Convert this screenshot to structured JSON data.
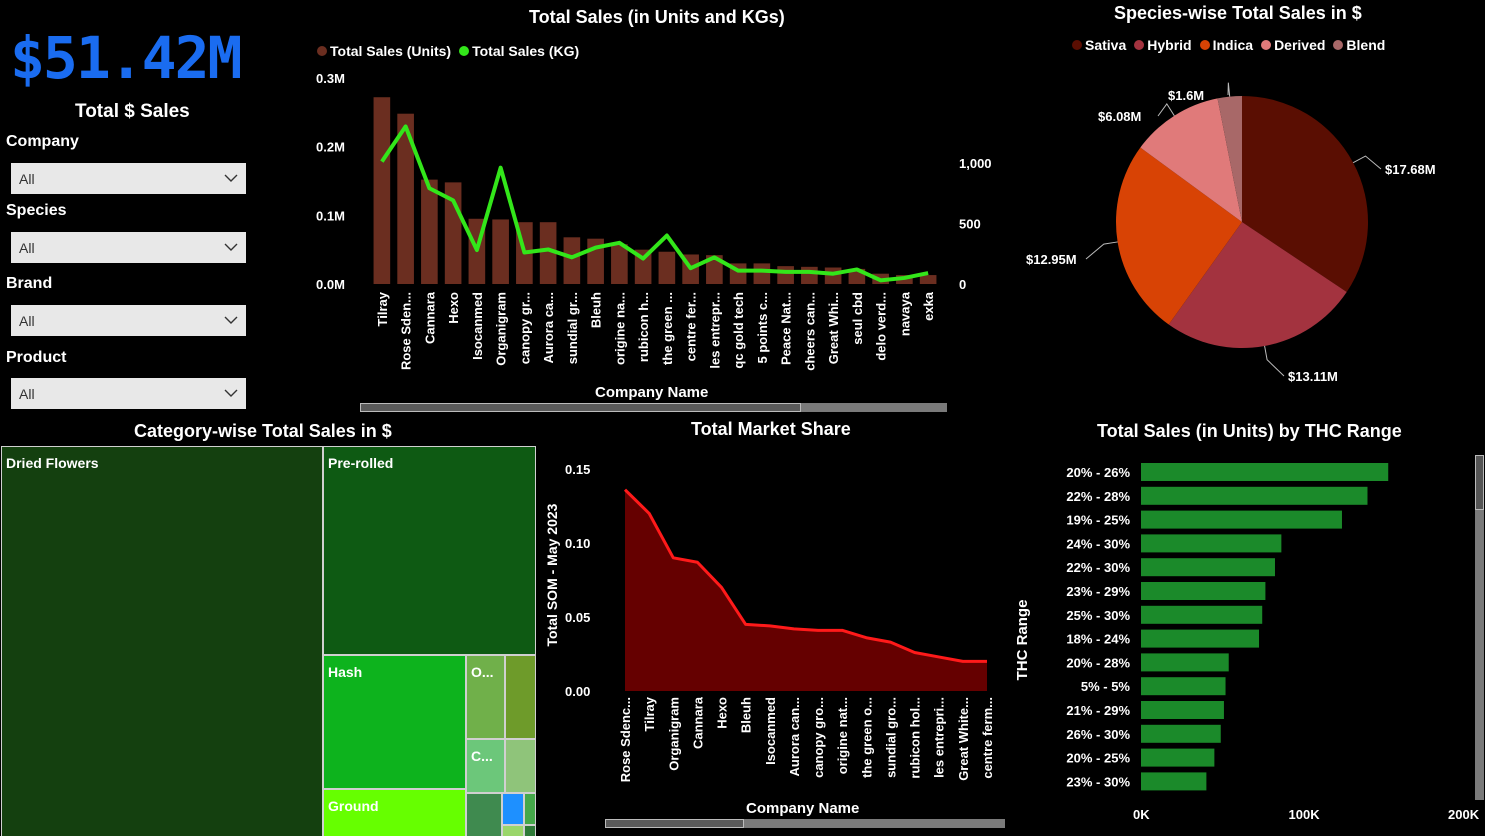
{
  "kpi": {
    "value": "$51.42M",
    "label": "Total $ Sales"
  },
  "slicers": [
    {
      "label": "Company",
      "value": "All"
    },
    {
      "label": "Species",
      "value": "All"
    },
    {
      "label": "Brand",
      "value": "All"
    },
    {
      "label": "Product",
      "value": "All"
    }
  ],
  "colors": {
    "units_bar": "#6b2e20",
    "kg_line": "#33e61a",
    "market_fill": "#650000",
    "market_line": "#ff1a1a",
    "thc_bar": "#1b8a2a",
    "kpi": "#1a6cf0"
  },
  "chart_data": [
    {
      "type": "bar",
      "title": "Total Sales (in Units and KGs)",
      "xlabel": "Company Name",
      "categories": [
        "Tilray",
        "Rose Sden...",
        "Cannara",
        "Hexo",
        "Isocanmed",
        "Organigram",
        "canopy gr...",
        "Aurora ca...",
        "sundial gr...",
        "Bleuh",
        "origine na...",
        "rubicon h...",
        "the green ...",
        "centre fer...",
        "les entrepr...",
        "qc gold tech",
        "5 points c...",
        "Peace Nat...",
        "cheers can...",
        "Great Whi...",
        "seul cbd",
        "delo verd...",
        "navaya",
        "exka"
      ],
      "y_ticks": [
        "0.3M",
        "0.2M",
        "0.1M",
        "0.0M"
      ],
      "y2_ticks": [
        "1,000",
        "500",
        "0"
      ],
      "ylim": [
        0,
        0.3
      ],
      "y2lim": [
        0,
        1000
      ],
      "series": [
        {
          "name": "Total Sales (Units)",
          "type": "bar",
          "values": [
            0.272,
            0.248,
            0.152,
            0.148,
            0.095,
            0.094,
            0.09,
            0.09,
            0.068,
            0.066,
            0.058,
            0.05,
            0.047,
            0.043,
            0.042,
            0.03,
            0.03,
            0.026,
            0.025,
            0.024,
            0.022,
            0.015,
            0.013,
            0.013
          ]
        },
        {
          "name": "Total Sales (KG)",
          "type": "line",
          "values": [
            1010,
            1300,
            790,
            690,
            280,
            960,
            260,
            285,
            220,
            300,
            340,
            210,
            400,
            130,
            220,
            110,
            110,
            100,
            100,
            85,
            120,
            30,
            50,
            90
          ]
        }
      ]
    },
    {
      "type": "pie",
      "title": "Species-wise Total Sales in $",
      "legend": [
        "Sativa",
        "Hybrid",
        "Indica",
        "Derived",
        "Blend"
      ],
      "slices": [
        {
          "name": "Sativa",
          "value": 17.68,
          "label": "$17.68M",
          "color": "#5a0e02"
        },
        {
          "name": "Hybrid",
          "value": 13.11,
          "label": "$13.11M",
          "color": "#a3333f"
        },
        {
          "name": "Indica",
          "value": 12.95,
          "label": "$12.95M",
          "color": "#d84305"
        },
        {
          "name": "Derived",
          "value": 6.08,
          "label": "$6.08M",
          "color": "#e07a7a"
        },
        {
          "name": "Blend",
          "value": 1.6,
          "label": "$1.6M",
          "color": "#a86868"
        }
      ]
    },
    {
      "type": "treemap",
      "title": "Category-wise Total Sales in $",
      "cells": [
        {
          "name": "Dried Flowers",
          "color": "#14400f"
        },
        {
          "name": "Pre-rolled",
          "color": "#0e5a13"
        },
        {
          "name": "Hash",
          "color": "#0db31d"
        },
        {
          "name": "Ground",
          "color": "#66ff00"
        },
        {
          "name": "O...",
          "color": "#70b04a"
        },
        {
          "name": "",
          "color": "#6e9b2a"
        },
        {
          "name": "C...",
          "color": "#6cc77a"
        },
        {
          "name": "",
          "color": "#8fc47a"
        },
        {
          "name": "",
          "color": "#3f8a4f"
        },
        {
          "name": "",
          "color": "#1e90ff"
        },
        {
          "name": "",
          "color": "#45a84a"
        },
        {
          "name": "",
          "color": "#9ad66a"
        },
        {
          "name": "",
          "color": "#2e7a38"
        }
      ]
    },
    {
      "type": "area",
      "title": "Total Market Share",
      "xlabel": "Company Name",
      "ylabel": "Total SOM - May 2023",
      "y_ticks": [
        "0.15",
        "0.10",
        "0.05",
        "0.00"
      ],
      "ylim": [
        0,
        0.15
      ],
      "categories": [
        "Rose Sdenc...",
        "Tilray",
        "Organigram",
        "Cannara",
        "Hexo",
        "Bleuh",
        "Isocanmed",
        "Aurora can...",
        "canopy gro...",
        "origine nat...",
        "the green o...",
        "sundial gro...",
        "rubicon hol...",
        "les entrepri...",
        "Great White...",
        "centre ferm..."
      ],
      "values": [
        0.136,
        0.12,
        0.09,
        0.087,
        0.07,
        0.045,
        0.044,
        0.042,
        0.041,
        0.041,
        0.036,
        0.033,
        0.026,
        0.023,
        0.02,
        0.02
      ]
    },
    {
      "type": "bar",
      "orientation": "horizontal",
      "title": "Total Sales (in Units) by THC Range",
      "ylabel": "THC Range",
      "x_ticks": [
        "0K",
        "100K",
        "200K"
      ],
      "xlim": [
        0,
        200000
      ],
      "categories": [
        "20% - 26%",
        "22% - 28%",
        "19% - 25%",
        "24% - 30%",
        "22% - 30%",
        "23% - 29%",
        "25% - 30%",
        "18% - 24%",
        "20% - 28%",
        "5% - 5%",
        "21% - 29%",
        "26% - 30%",
        "20% - 25%",
        "23% - 30%"
      ],
      "values": [
        155000,
        142000,
        126000,
        88000,
        84000,
        78000,
        76000,
        74000,
        55000,
        53000,
        52000,
        50000,
        46000,
        41000
      ]
    }
  ]
}
